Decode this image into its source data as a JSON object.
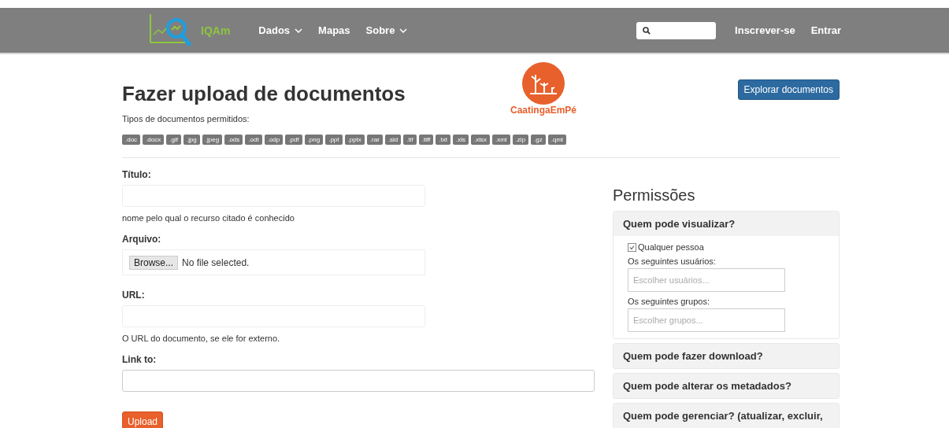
{
  "navbar": {
    "logo_text": "IQAm",
    "menu": [
      {
        "label": "Dados",
        "dropdown": true
      },
      {
        "label": "Mapas",
        "dropdown": false
      },
      {
        "label": "Sobre",
        "dropdown": true
      }
    ],
    "links": [
      "Inscrever-se",
      "Entrar"
    ]
  },
  "header": {
    "title": "Fazer upload de documentos",
    "allowed_types_label": "Tipos de documentos permitidos:",
    "allowed_types": [
      ".doc",
      ".docx",
      ".gif",
      ".jpg",
      ".jpeg",
      ".ods",
      ".odt",
      ".odp",
      ".pdf",
      ".png",
      ".ppt",
      ".pptx",
      ".rar",
      ".sld",
      ".tif",
      ".tiff",
      ".txt",
      ".xls",
      ".xlsx",
      ".xml",
      ".zip",
      ".gz",
      ".qml"
    ],
    "partner_logo_text": "CaatingaEmPé",
    "explore_button": "Explorar documentos"
  },
  "form": {
    "fields": [
      {
        "kind": "text",
        "label": "Título:",
        "help": "nome pelo qual o recurso citado é conhecido"
      },
      {
        "kind": "file",
        "label": "Arquivo:",
        "button": "Browse...",
        "status": "No file selected."
      },
      {
        "kind": "text",
        "label": "URL:",
        "help": "O URL do documento, se ele for externo."
      },
      {
        "kind": "wide",
        "label": "Link to:"
      }
    ],
    "submit": "Upload"
  },
  "permissions": {
    "title": "Permissões",
    "panels": [
      {
        "heading": "Quem pode visualizar?",
        "expanded": true,
        "anyone": {
          "label": "Qualquer pessoa",
          "checked": true
        },
        "users_label": "Os seguintes usuários:",
        "users_placeholder": "Escolher usuários...",
        "groups_label": "Os seguintes grupos:",
        "groups_placeholder": "Escolher grupos..."
      },
      {
        "heading": "Quem pode fazer download?",
        "expanded": false
      },
      {
        "heading": "Quem pode alterar os metadados?",
        "expanded": false
      },
      {
        "heading": "Quem pode gerenciar? (atualizar, excluir,",
        "expanded": false
      }
    ]
  }
}
